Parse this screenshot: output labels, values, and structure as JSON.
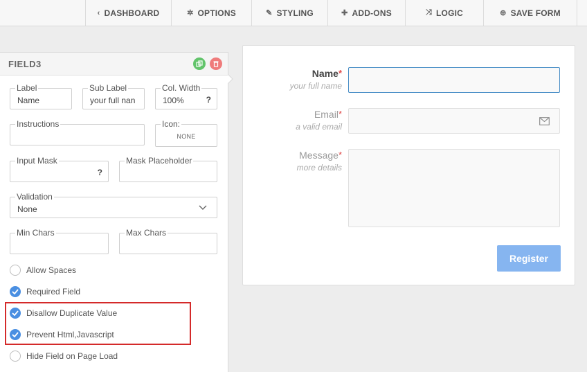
{
  "nav": {
    "items": [
      {
        "label": "DASHBOARD",
        "icon": "chevron-left-icon"
      },
      {
        "label": "OPTIONS",
        "icon": "gears-icon"
      },
      {
        "label": "STYLING",
        "icon": "pencil-icon"
      },
      {
        "label": "ADD-ONS",
        "icon": "puzzle-icon"
      },
      {
        "label": "LOGIC",
        "icon": "shuffle-icon"
      },
      {
        "label": "SAVE FORM",
        "icon": "save-icon"
      }
    ]
  },
  "panel": {
    "title": "FIELD3",
    "colors": {
      "duplicate": "#62c46b",
      "delete": "#ef7b7b",
      "check": "#4a8fe2",
      "highlight": "#d42a2a"
    },
    "fields": {
      "label": {
        "legend": "Label",
        "value": "Name"
      },
      "sub_label": {
        "legend": "Sub Label",
        "value": "your full nan"
      },
      "col_width": {
        "legend": "Col. Width",
        "value": "100%",
        "help": "?"
      },
      "instructions": {
        "legend": "Instructions",
        "value": ""
      },
      "icon": {
        "legend": "Icon:",
        "value": "NONE"
      },
      "input_mask": {
        "legend": "Input Mask",
        "value": "",
        "help": "?"
      },
      "mask_placeholder": {
        "legend": "Mask Placeholder",
        "value": ""
      },
      "validation": {
        "legend": "Validation",
        "value": "None"
      },
      "min_chars": {
        "legend": "Min Chars",
        "value": ""
      },
      "max_chars": {
        "legend": "Max Chars",
        "value": ""
      }
    },
    "options": [
      {
        "label": "Allow Spaces",
        "checked": false
      },
      {
        "label": "Required Field",
        "checked": true
      },
      {
        "label": "Disallow Duplicate Value",
        "checked": true
      },
      {
        "label": "Prevent Html,Javascript",
        "checked": true
      },
      {
        "label": "Hide Field on Page Load",
        "checked": false
      }
    ]
  },
  "form": {
    "fields": [
      {
        "label": "Name",
        "required": "*",
        "sub": "your full name"
      },
      {
        "label": "Email",
        "required": "*",
        "sub": "a valid email",
        "icon": "envelope-icon"
      },
      {
        "label": "Message",
        "required": "*",
        "sub": "more details"
      }
    ],
    "submit_label": "Register",
    "colors": {
      "label_active": "#444444",
      "label_muted": "#999999",
      "submit": "#86b5f0",
      "input_focus": "#4a8fc7"
    }
  }
}
